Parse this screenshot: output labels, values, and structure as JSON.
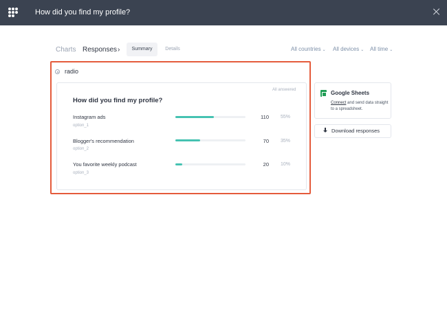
{
  "header": {
    "title": "How did you find my profile?",
    "logo_icon": "dots-grid-logo-icon",
    "close_icon": "close-icon"
  },
  "breadcrumb": {
    "charts": "Charts",
    "responses": "Responses",
    "separator": "›"
  },
  "tabs": {
    "summary": "Summary",
    "details": "Details"
  },
  "filters": {
    "countries": "All countries",
    "devices": "All devices",
    "time": "All time"
  },
  "question": {
    "type_label": "radio",
    "status": "All answered",
    "title": "How did you find my profile?",
    "options": [
      {
        "label": "Instagram ads",
        "key": "option_1",
        "count": "110",
        "percent": "55%",
        "fraction": 0.55
      },
      {
        "label": "Blogger's recommendation",
        "key": "option_2",
        "count": "70",
        "percent": "35%",
        "fraction": 0.35
      },
      {
        "label": "You favorite weekly podcast",
        "key": "option_3",
        "count": "20",
        "percent": "10%",
        "fraction": 0.1
      }
    ]
  },
  "sidebar": {
    "google_sheets_title": "Google Sheets",
    "connect_link": "Connect",
    "connect_desc": " and send data straight to a spreadsheet.",
    "download_label": "Download responses",
    "download_icon": "download-icon",
    "sheets_icon": "google-sheets-icon"
  },
  "colors": {
    "topbar": "#3b4351",
    "bar_fill": "#45c2b1",
    "highlight_border": "#e45a3a",
    "sheets_green": "#1f9d55"
  }
}
